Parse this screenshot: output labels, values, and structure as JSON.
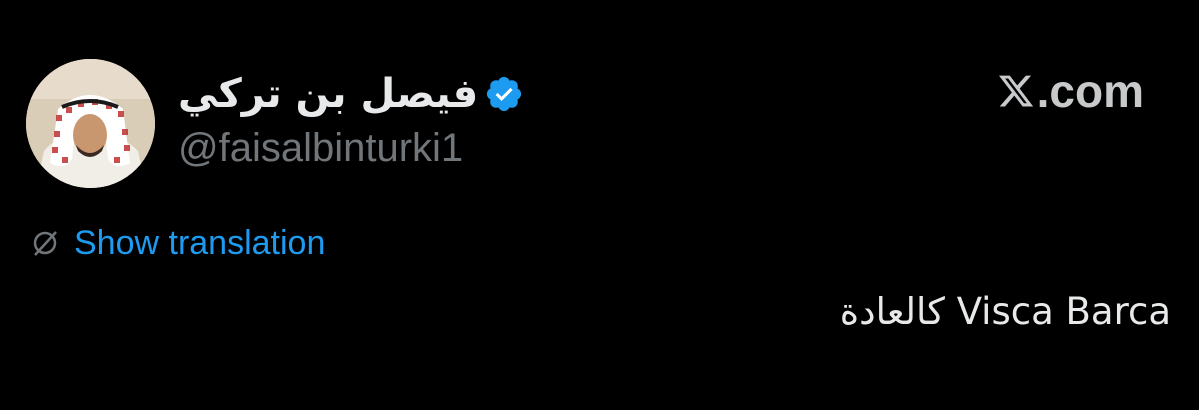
{
  "author": {
    "display_name": "فيصل بن تركي",
    "handle": "@faisalbinturki1",
    "verified": true,
    "avatar_icon": "profile-photo"
  },
  "brand": {
    "text": ".com",
    "icon": "x-logo-icon"
  },
  "translation": {
    "label": "Show translation",
    "icon": "globe-icon",
    "color": "#1d9bf0"
  },
  "tweet": {
    "text": "Visca Barca كالعادة"
  },
  "colors": {
    "background": "#000000",
    "primary_text": "#e7e9ea",
    "secondary_text": "#71767b",
    "verified_badge": "#1d9bf0"
  }
}
